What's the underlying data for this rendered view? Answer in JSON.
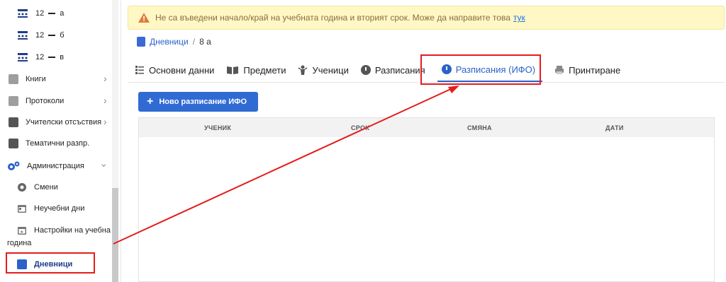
{
  "sidebar": {
    "classes": [
      {
        "grade": "12",
        "section": "а"
      },
      {
        "grade": "12",
        "section": "б"
      },
      {
        "grade": "12",
        "section": "в"
      }
    ],
    "items": [
      {
        "label": "Книги",
        "icon": "books-icon",
        "has_chevron": true
      },
      {
        "label": "Протоколи",
        "icon": "protocols-icon",
        "has_chevron": true
      },
      {
        "label": "Учителски отсъствия",
        "icon": "teacher-absence-icon",
        "has_chevron": true
      },
      {
        "label": "Тематични разпр.",
        "icon": "book-icon",
        "has_chevron": false
      },
      {
        "label": "Администрация",
        "icon": "gears-icon",
        "has_chevron": true
      }
    ],
    "admin_items": [
      {
        "label": "Смени",
        "icon": "shifts-icon"
      },
      {
        "label": "Неучебни дни",
        "icon": "calendar-icon"
      },
      {
        "label_line1": "Настройки на учебна",
        "label_line2": "година",
        "icon": "calendar-star-icon"
      },
      {
        "label": "Дневници",
        "icon": "book-icon"
      }
    ]
  },
  "banner": {
    "text": "Не са въведени начало/край на учебната година и вторият срок. Може да направите това",
    "link": "тук"
  },
  "breadcrumb": {
    "parent": "Дневници",
    "separator": "/",
    "current": "8 а"
  },
  "tabs": [
    {
      "label": "Основни данни",
      "icon": "list-icon"
    },
    {
      "label": "Предмети",
      "icon": "open-book-icon"
    },
    {
      "label": "Ученици",
      "icon": "student-icon"
    },
    {
      "label": "Разписания",
      "icon": "clock-icon"
    },
    {
      "label": "Разписания (ИФО)",
      "icon": "clock-icon",
      "active": true
    },
    {
      "label": "Принтиране",
      "icon": "print-icon"
    }
  ],
  "button": {
    "label": "Ново разписание ИФО"
  },
  "table": {
    "columns": [
      "УЧЕНИК",
      "СРОК",
      "СМЯНА",
      "ДАТИ"
    ],
    "rows": []
  },
  "colors": {
    "accent": "#2a62c9",
    "highlight": "#e51c1c",
    "banner_bg": "#fff8c5"
  }
}
